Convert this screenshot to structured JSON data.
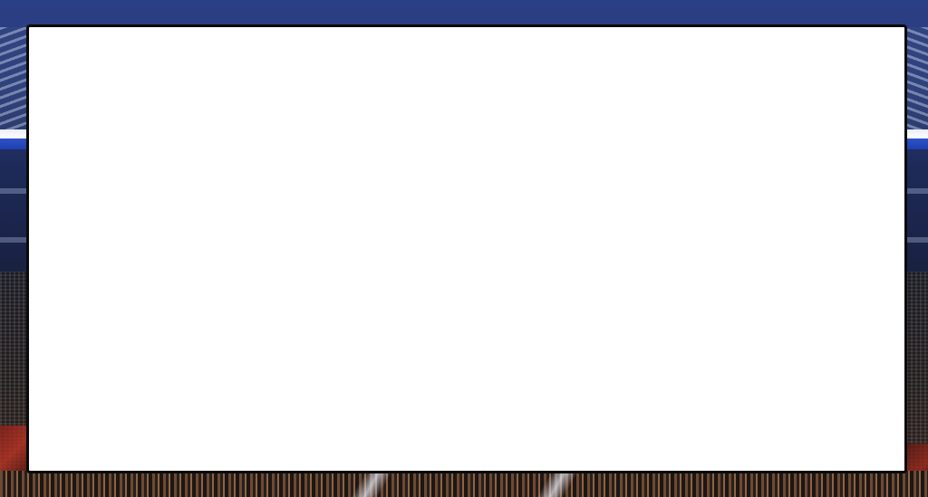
{
  "background": {
    "scene": "stadium",
    "colors": {
      "sky_top": "#2b3f86",
      "crowd_dark": "#23232d",
      "crowd_warm": "#3b2a22",
      "ad_board_blue": "#2d52c8",
      "accent_red": "#b83322"
    }
  },
  "panel": {
    "background_color": "#ffffff",
    "border_color": "#0a0a0a",
    "content": ""
  }
}
